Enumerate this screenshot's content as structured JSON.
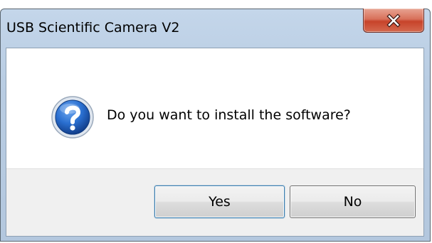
{
  "window": {
    "title": "USB Scientific Camera V2",
    "close_icon": "close-icon"
  },
  "dialog": {
    "icon": "question-icon",
    "message": "Do you want to install the software?"
  },
  "buttons": {
    "yes_label": "Yes",
    "no_label": "No"
  },
  "colors": {
    "close_button": "#c7432a",
    "frame": "#b9cde3",
    "question_icon": "#1f5fb8",
    "button_face": "#e6e6e6",
    "button_area": "#f0f0f0"
  }
}
